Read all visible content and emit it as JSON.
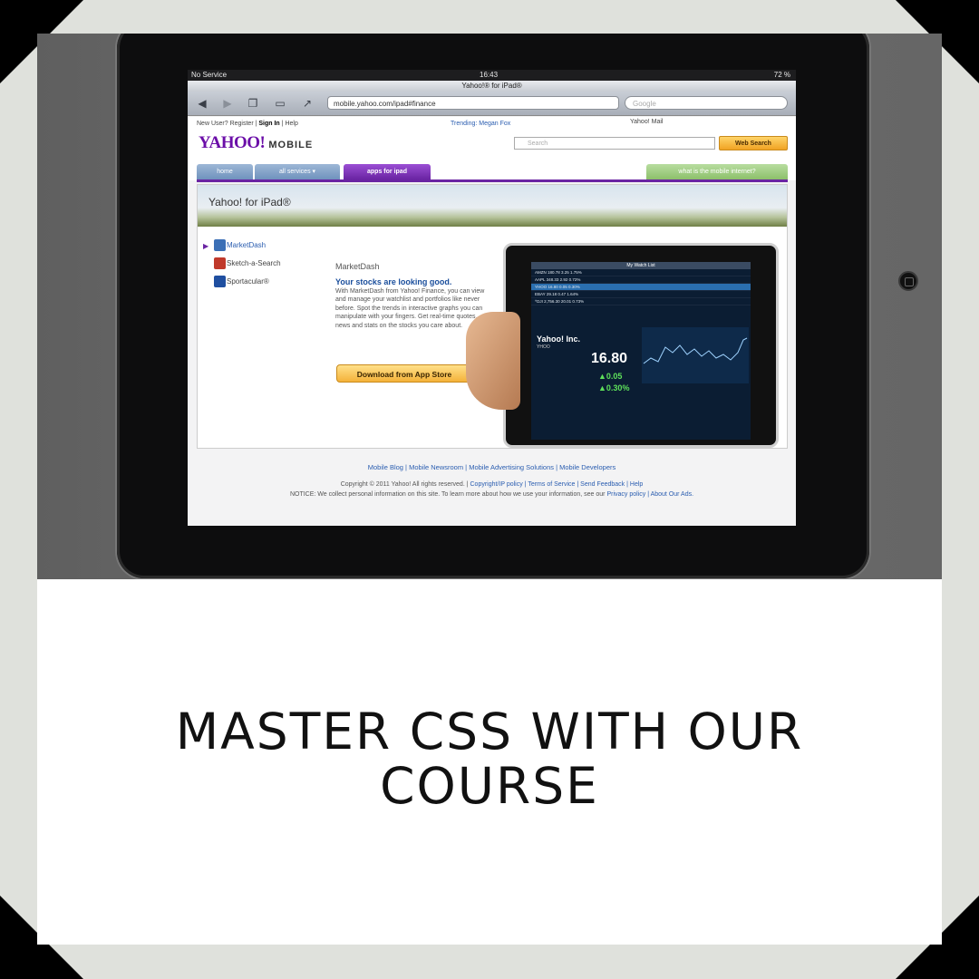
{
  "caption": {
    "line1": "MASTER CSS WITH OUR",
    "line2": "COURSE"
  },
  "status_bar": {
    "carrier": "No Service",
    "time": "16:43",
    "battery": "72 %"
  },
  "browser": {
    "title": "Yahoo!® for iPad®",
    "url": "mobile.yahoo.com/ipad#finance",
    "search_placeholder": "Google"
  },
  "yahoo": {
    "new_user": "New User?",
    "register": "Register",
    "sign_in": "Sign In",
    "help": "Help",
    "trending": "Trending: Megan Fox",
    "mini_links": "Yahoo!  Mail",
    "logo": "YAHOO!",
    "logo_suffix": "MOBILE",
    "search_placeholder": "Search",
    "web_search": "Web Search",
    "tabs": [
      "home",
      "all services ▾",
      "apps for ipad",
      "what is the mobile internet?"
    ],
    "banner_title": "Yahoo! for iPad®",
    "sidebar": [
      "MarketDash",
      "Sketch-a-Search",
      "Sportacular®"
    ],
    "promo": {
      "app_name": "MarketDash",
      "headline": "Your stocks are looking good.",
      "body": "With MarketDash from Yahoo! Finance, you can view and manage your watchlist and portfolios like never before. Spot the trends in interactive graphs you can manipulate with your fingers. Get real-time quotes, news and stats on the stocks you care about.",
      "button": "Download from App Store"
    },
    "tablet": {
      "watchlist_title": "My Watch List",
      "rows": [
        "AMZN   180.78   3.25   1.75%",
        "AAPL   348.33   2.92   0.72%",
        "YHOO   16.80   0.05   0.30%",
        "EBAY   29.18   0.47   1.64%",
        "^DJI   2,756.30   20.01   0.73%"
      ],
      "quote_name": "Yahoo! Inc.",
      "quote_symbol": "YHOO",
      "quote_price": "16.80",
      "quote_change": "0.05",
      "quote_pct": "0.30%"
    },
    "footer_links": "Mobile Blog | Mobile Newsroom | Mobile Advertising Solutions | Mobile Developers",
    "copyright": "Copyright © 2011 Yahoo! All rights reserved. |",
    "copyright_links": "Copyright/IP policy | Terms of Service | Send Feedback | Help",
    "notice": "NOTICE: We collect personal information on this site. To learn more about how we use your information, see our",
    "notice_links": "Privacy policy | About Our Ads."
  },
  "colors": {
    "yahoo_purple": "#6a24a3",
    "link_blue": "#2a5db0",
    "button_orange": "#f4b23a"
  }
}
